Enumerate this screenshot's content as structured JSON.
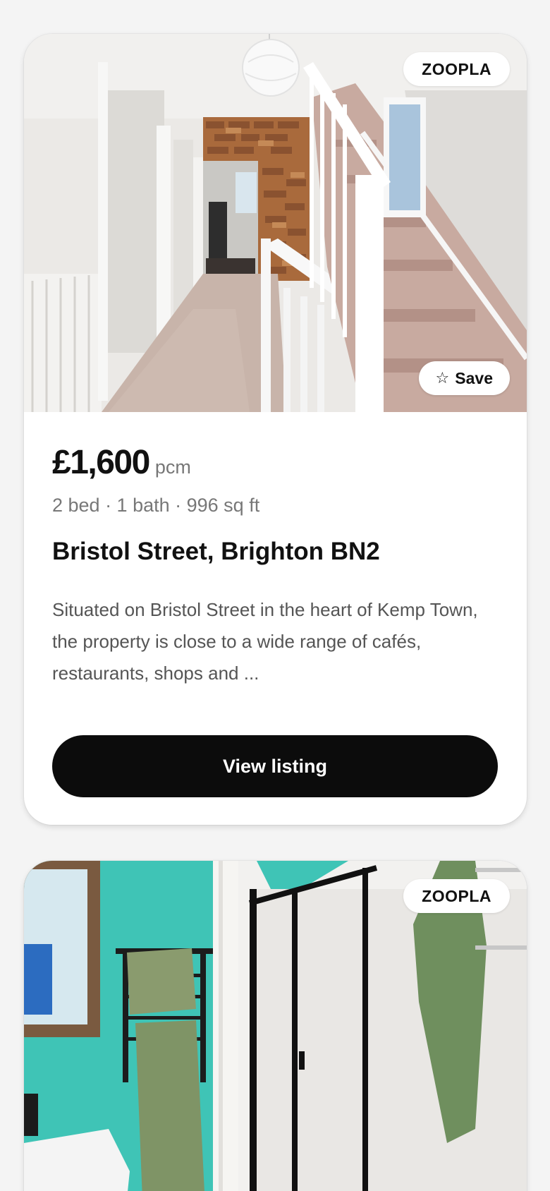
{
  "listings": [
    {
      "source": "ZOOPLA",
      "save_label": "Save",
      "save_icon": "star-outline-icon",
      "price": "£1,600",
      "price_unit": "pcm",
      "specs": "2 bed · 1 bath · 996 sq ft",
      "address": "Bristol Street, Brighton BN2",
      "description": "Situated on Bristol Street in the heart of Kemp Town, the property is close to a wide range of cafés, restaurants, shops and ...",
      "cta_label": "View listing"
    },
    {
      "source": "ZOOPLA"
    }
  ],
  "colors": {
    "page_background": "#f4f4f4",
    "card_background": "#ffffff",
    "cta_background": "#0c0c0c",
    "cta_text": "#ffffff",
    "muted_text": "#777777"
  }
}
